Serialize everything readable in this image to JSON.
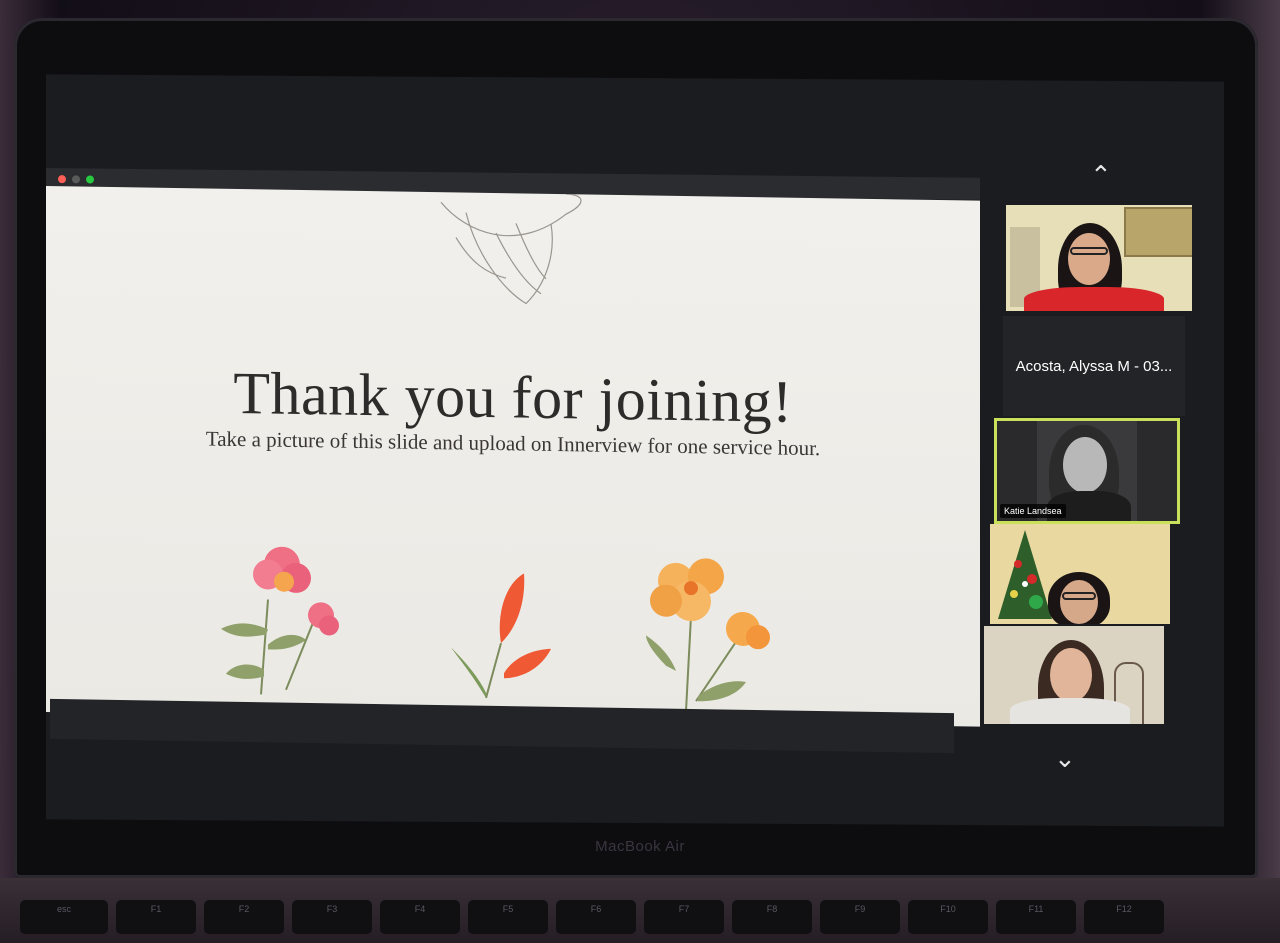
{
  "slide": {
    "title": "Thank you for joining!",
    "subtitle": "Take a picture of this slide and upload on Innerview for one service hour."
  },
  "participants": [
    {
      "label": ""
    },
    {
      "label": "Acosta, Alyssa M - 03..."
    },
    {
      "label": "Katie Landsea"
    },
    {
      "label": ""
    },
    {
      "label": ""
    }
  ],
  "device": {
    "brand": "MacBook Air"
  },
  "icons": {
    "scroll_up": "chevron-up-icon",
    "scroll_down": "chevron-down-icon"
  },
  "colors": {
    "active_speaker_border": "#c8e05a",
    "window_close": "#ff5f57",
    "window_min": "#5a5a5a",
    "window_max": "#28c840"
  },
  "keyboard": {
    "keys": [
      "esc",
      "F1",
      "F2",
      "F3",
      "F4",
      "F5",
      "F6",
      "F7",
      "F8",
      "F9",
      "F10",
      "F11",
      "F12"
    ]
  }
}
